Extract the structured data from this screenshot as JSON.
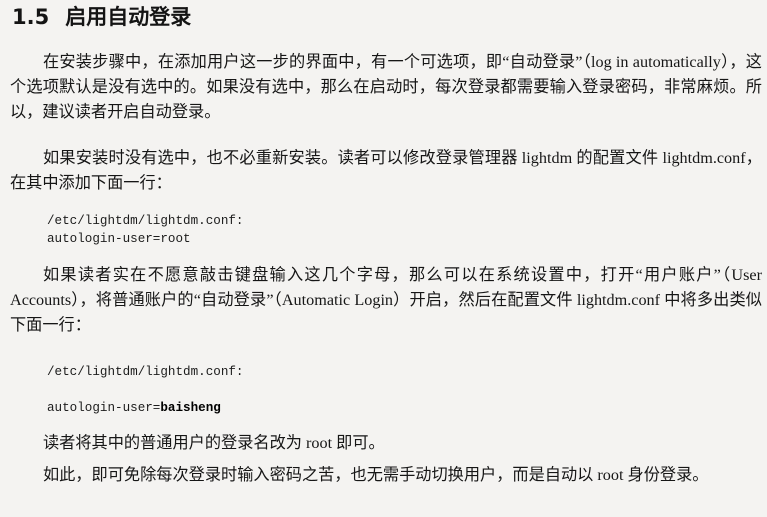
{
  "section": {
    "number": "1.5",
    "title": "启用自动登录"
  },
  "paragraphs": {
    "p1": "在安装步骤中，在添加用户这一步的界面中，有一个可选项，即“自动登录”（log in automatically），这个选项默认是没有选中的。如果没有选中，那么在启动时，每次登录都需要输入登录密码，非常麻烦。所以，建议读者开启自动登录。",
    "p2": "如果安装时没有选中，也不必重新安装。读者可以修改登录管理器 lightdm 的配置文件 lightdm.conf，在其中添加下面一行：",
    "p3": "如果读者实在不愿意敲击键盘输入这几个字母，那么可以在系统设置中，打开“用户账户”（User Accounts），将普通账户的“自动登录”（Automatic Login）开启，然后在配置文件 lightdm.conf 中将多出类似下面一行：",
    "p4": "读者将其中的普通用户的登录名改为 root 即可。",
    "p5": "如此，即可免除每次登录时输入密码之苦，也无需手动切换用户，而是自动以 root 身份登录。"
  },
  "code1": {
    "line1": "/etc/lightdm/lightdm.conf:",
    "line2": "autologin-user=root"
  },
  "code2": {
    "line1": "/etc/lightdm/lightdm.conf:",
    "line2_prefix": "autologin-user=",
    "line2_value": "baisheng"
  }
}
